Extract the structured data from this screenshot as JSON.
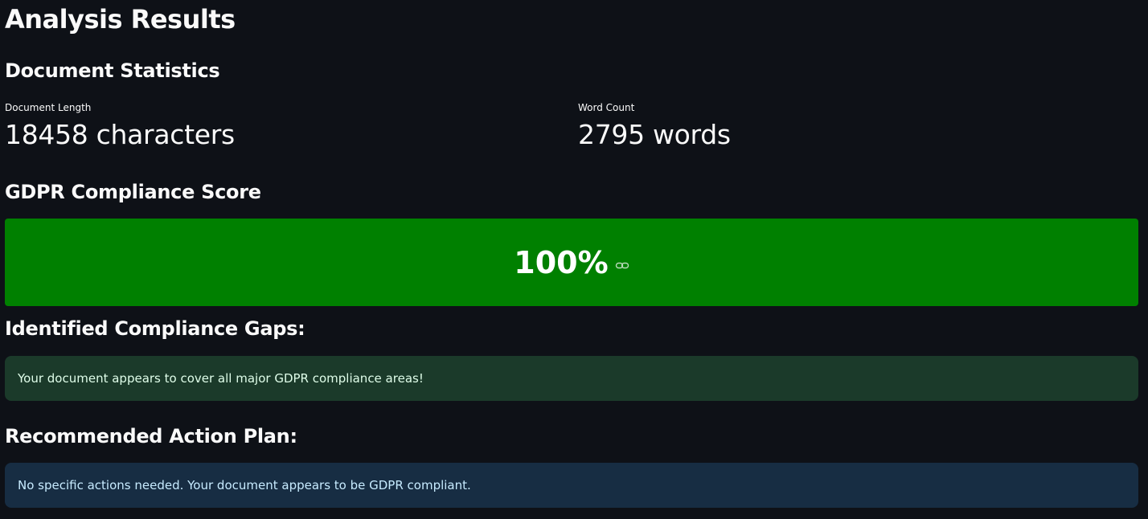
{
  "page": {
    "title": "Analysis Results"
  },
  "stats": {
    "heading": "Document Statistics",
    "length_label": "Document Length",
    "length_value": "18458 characters",
    "words_label": "Word Count",
    "words_value": "2795 words"
  },
  "score": {
    "heading": "GDPR Compliance Score",
    "value": "100%",
    "bar_color": "#008000",
    "icon": "link-icon"
  },
  "gaps": {
    "heading": "Identified Compliance Gaps:",
    "message": "Your document appears to cover all major GDPR compliance areas!",
    "color": "#1b3a2a"
  },
  "plan": {
    "heading": "Recommended Action Plan:",
    "message": "No specific actions needed. Your document appears to be GDPR compliant.",
    "color": "#172d43"
  }
}
